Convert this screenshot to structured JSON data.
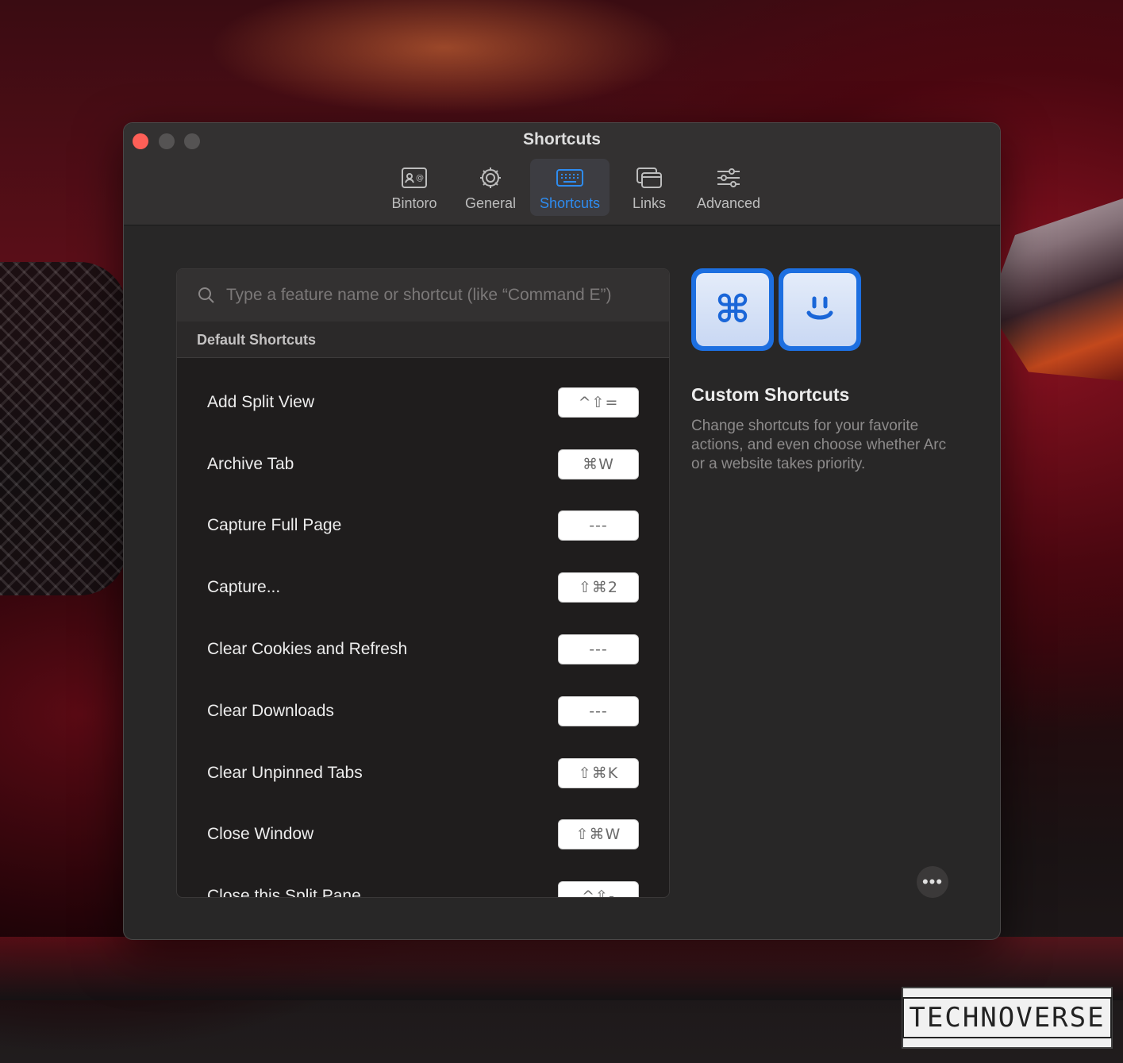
{
  "window": {
    "title": "Shortcuts"
  },
  "tabs": [
    {
      "label": "Bintoro",
      "icon": "profile-card-icon",
      "active": false
    },
    {
      "label": "General",
      "icon": "gear-icon",
      "active": false
    },
    {
      "label": "Shortcuts",
      "icon": "keyboard-icon",
      "active": true
    },
    {
      "label": "Links",
      "icon": "windows-icon",
      "active": false
    },
    {
      "label": "Advanced",
      "icon": "sliders-icon",
      "active": false
    }
  ],
  "search": {
    "placeholder": "Type a feature name or shortcut (like “Command E”)"
  },
  "section": {
    "title": "Default Shortcuts"
  },
  "shortcuts": [
    {
      "label": "Add Split View",
      "keys": "^⇧="
    },
    {
      "label": "Archive Tab",
      "keys": "⌘W"
    },
    {
      "label": "Capture Full Page",
      "keys": "---"
    },
    {
      "label": "Capture...",
      "keys": "⇧⌘2"
    },
    {
      "label": "Clear Cookies and Refresh",
      "keys": "---"
    },
    {
      "label": "Clear Downloads",
      "keys": "---"
    },
    {
      "label": "Clear Unpinned Tabs",
      "keys": "⇧⌘K"
    },
    {
      "label": "Close Window",
      "keys": "⇧⌘W"
    },
    {
      "label": "Close this Split Pane",
      "keys": "^⇧-"
    }
  ],
  "promo": {
    "icon_left": "⌘",
    "icon_right": "smiley-icon",
    "title": "Custom Shortcuts",
    "description": "Change shortcuts for your favorite actions, and even choose whether Arc or a website takes priority."
  },
  "more_button": {
    "label": "•••"
  },
  "watermark": {
    "text": "TECHNOVERSE"
  },
  "colors": {
    "accent": "#2e8cf0",
    "close": "#fe5f57",
    "window_bg": "#282727"
  }
}
